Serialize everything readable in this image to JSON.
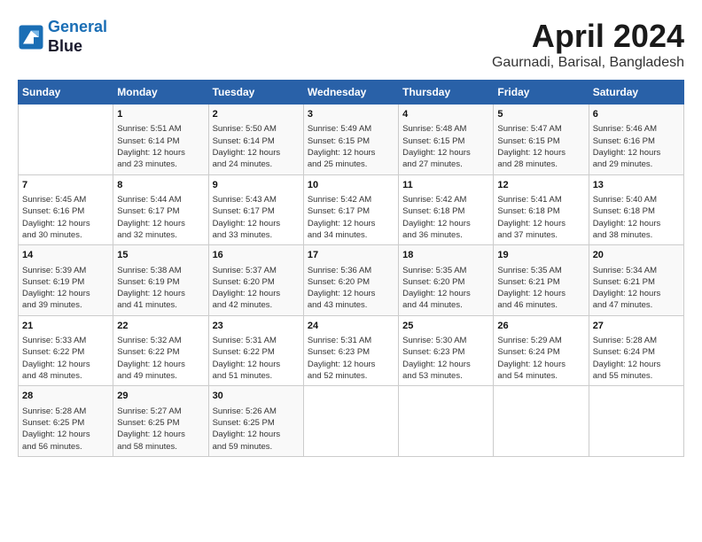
{
  "header": {
    "logo_line1": "General",
    "logo_line2": "Blue",
    "month_year": "April 2024",
    "location": "Gaurnadi, Barisal, Bangladesh"
  },
  "days_of_week": [
    "Sunday",
    "Monday",
    "Tuesday",
    "Wednesday",
    "Thursday",
    "Friday",
    "Saturday"
  ],
  "weeks": [
    [
      {
        "day": "",
        "info": ""
      },
      {
        "day": "1",
        "info": "Sunrise: 5:51 AM\nSunset: 6:14 PM\nDaylight: 12 hours\nand 23 minutes."
      },
      {
        "day": "2",
        "info": "Sunrise: 5:50 AM\nSunset: 6:14 PM\nDaylight: 12 hours\nand 24 minutes."
      },
      {
        "day": "3",
        "info": "Sunrise: 5:49 AM\nSunset: 6:15 PM\nDaylight: 12 hours\nand 25 minutes."
      },
      {
        "day": "4",
        "info": "Sunrise: 5:48 AM\nSunset: 6:15 PM\nDaylight: 12 hours\nand 27 minutes."
      },
      {
        "day": "5",
        "info": "Sunrise: 5:47 AM\nSunset: 6:15 PM\nDaylight: 12 hours\nand 28 minutes."
      },
      {
        "day": "6",
        "info": "Sunrise: 5:46 AM\nSunset: 6:16 PM\nDaylight: 12 hours\nand 29 minutes."
      }
    ],
    [
      {
        "day": "7",
        "info": "Sunrise: 5:45 AM\nSunset: 6:16 PM\nDaylight: 12 hours\nand 30 minutes."
      },
      {
        "day": "8",
        "info": "Sunrise: 5:44 AM\nSunset: 6:17 PM\nDaylight: 12 hours\nand 32 minutes."
      },
      {
        "day": "9",
        "info": "Sunrise: 5:43 AM\nSunset: 6:17 PM\nDaylight: 12 hours\nand 33 minutes."
      },
      {
        "day": "10",
        "info": "Sunrise: 5:42 AM\nSunset: 6:17 PM\nDaylight: 12 hours\nand 34 minutes."
      },
      {
        "day": "11",
        "info": "Sunrise: 5:42 AM\nSunset: 6:18 PM\nDaylight: 12 hours\nand 36 minutes."
      },
      {
        "day": "12",
        "info": "Sunrise: 5:41 AM\nSunset: 6:18 PM\nDaylight: 12 hours\nand 37 minutes."
      },
      {
        "day": "13",
        "info": "Sunrise: 5:40 AM\nSunset: 6:18 PM\nDaylight: 12 hours\nand 38 minutes."
      }
    ],
    [
      {
        "day": "14",
        "info": "Sunrise: 5:39 AM\nSunset: 6:19 PM\nDaylight: 12 hours\nand 39 minutes."
      },
      {
        "day": "15",
        "info": "Sunrise: 5:38 AM\nSunset: 6:19 PM\nDaylight: 12 hours\nand 41 minutes."
      },
      {
        "day": "16",
        "info": "Sunrise: 5:37 AM\nSunset: 6:20 PM\nDaylight: 12 hours\nand 42 minutes."
      },
      {
        "day": "17",
        "info": "Sunrise: 5:36 AM\nSunset: 6:20 PM\nDaylight: 12 hours\nand 43 minutes."
      },
      {
        "day": "18",
        "info": "Sunrise: 5:35 AM\nSunset: 6:20 PM\nDaylight: 12 hours\nand 44 minutes."
      },
      {
        "day": "19",
        "info": "Sunrise: 5:35 AM\nSunset: 6:21 PM\nDaylight: 12 hours\nand 46 minutes."
      },
      {
        "day": "20",
        "info": "Sunrise: 5:34 AM\nSunset: 6:21 PM\nDaylight: 12 hours\nand 47 minutes."
      }
    ],
    [
      {
        "day": "21",
        "info": "Sunrise: 5:33 AM\nSunset: 6:22 PM\nDaylight: 12 hours\nand 48 minutes."
      },
      {
        "day": "22",
        "info": "Sunrise: 5:32 AM\nSunset: 6:22 PM\nDaylight: 12 hours\nand 49 minutes."
      },
      {
        "day": "23",
        "info": "Sunrise: 5:31 AM\nSunset: 6:22 PM\nDaylight: 12 hours\nand 51 minutes."
      },
      {
        "day": "24",
        "info": "Sunrise: 5:31 AM\nSunset: 6:23 PM\nDaylight: 12 hours\nand 52 minutes."
      },
      {
        "day": "25",
        "info": "Sunrise: 5:30 AM\nSunset: 6:23 PM\nDaylight: 12 hours\nand 53 minutes."
      },
      {
        "day": "26",
        "info": "Sunrise: 5:29 AM\nSunset: 6:24 PM\nDaylight: 12 hours\nand 54 minutes."
      },
      {
        "day": "27",
        "info": "Sunrise: 5:28 AM\nSunset: 6:24 PM\nDaylight: 12 hours\nand 55 minutes."
      }
    ],
    [
      {
        "day": "28",
        "info": "Sunrise: 5:28 AM\nSunset: 6:25 PM\nDaylight: 12 hours\nand 56 minutes."
      },
      {
        "day": "29",
        "info": "Sunrise: 5:27 AM\nSunset: 6:25 PM\nDaylight: 12 hours\nand 58 minutes."
      },
      {
        "day": "30",
        "info": "Sunrise: 5:26 AM\nSunset: 6:25 PM\nDaylight: 12 hours\nand 59 minutes."
      },
      {
        "day": "",
        "info": ""
      },
      {
        "day": "",
        "info": ""
      },
      {
        "day": "",
        "info": ""
      },
      {
        "day": "",
        "info": ""
      }
    ]
  ]
}
